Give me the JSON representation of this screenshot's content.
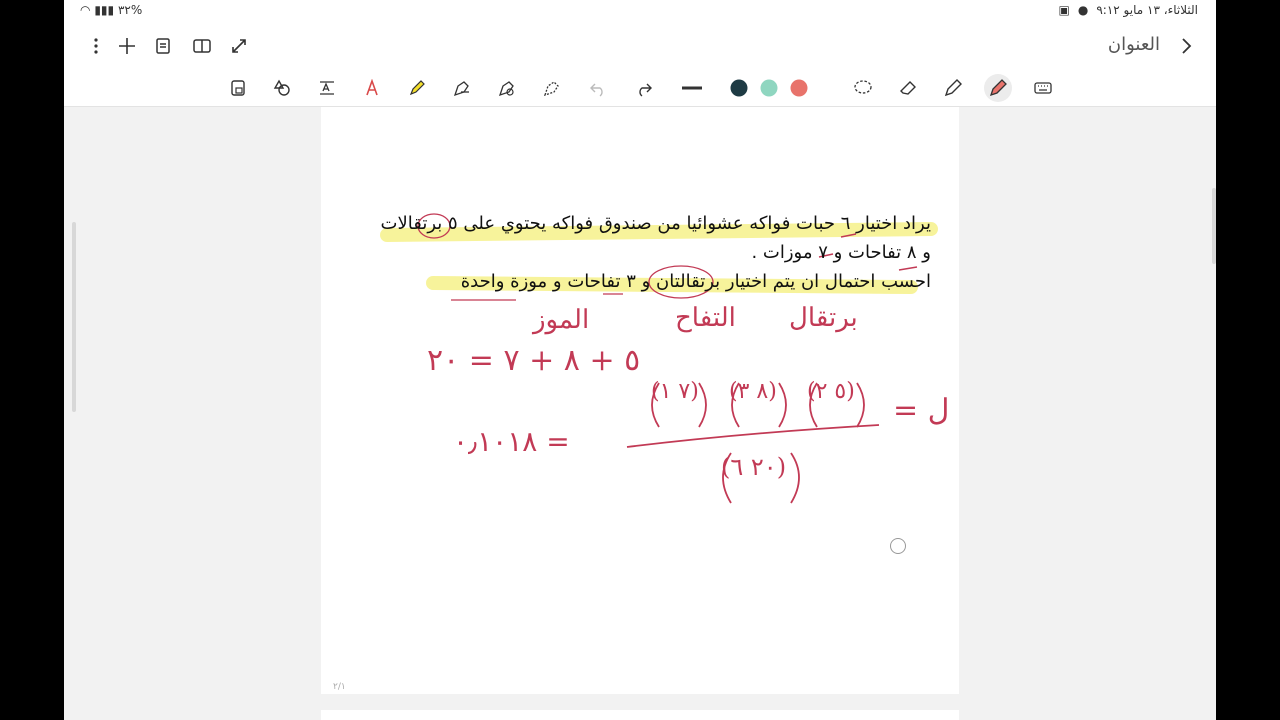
{
  "status": {
    "datetime": "الثلاثاء، ١٣ مايو ٩:١٢",
    "battery": "%٣٢"
  },
  "appbar": {
    "title": "العنوان",
    "icons": [
      "more-icon",
      "add-icon",
      "page-list-icon",
      "book-view-icon",
      "fullscreen-icon",
      "back-icon"
    ]
  },
  "toolbar": {
    "pen_colors": [
      "#1e3b44",
      "#8fd6c0",
      "#e8736b"
    ]
  },
  "document": {
    "line1": "يراد اختيار ٦ حبات فواكه عشوائيا من صندوق فواكه يحتوي على ٥ برتقالات",
    "line2": "و ٨ تفاحات و ٧ موزات .",
    "line3": "احسب احتمال ان يتم اختيار برتقالتان و ٣ تفاحات و موزة واحدة",
    "page_number": "٢/١"
  },
  "handwriting": {
    "label_orange": "برتقال",
    "label_apple": "التفاح",
    "label_banana": "الموز",
    "sum_line": "٥ + ٨ + ٧ = ٢٠",
    "prob_label": "ل =",
    "num1": "(٥ ٢)",
    "num2": "(٨ ٣)",
    "num3": "(٧ ١)",
    "denominator": "(٢٠ ٦)",
    "result": "= ٠٫١٠١٨"
  }
}
